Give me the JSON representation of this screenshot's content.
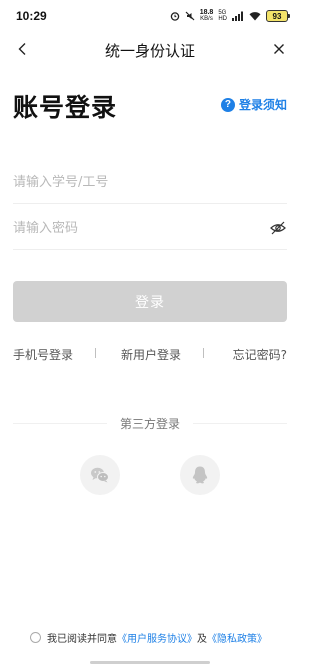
{
  "status_bar": {
    "time": "10:29",
    "net_speed": "18.8",
    "net_unit": "KB/s",
    "net_type_top": "5G",
    "net_type_bottom": "HD",
    "battery": "93",
    "battery_color": "#f3e36a"
  },
  "nav": {
    "title": "统一身份认证",
    "back_icon": "chevron-left-icon",
    "close_icon": "close-icon"
  },
  "page": {
    "heading": "账号登录",
    "notice_label": "登录须知",
    "accent_color": "#1e80e6"
  },
  "form": {
    "username_placeholder": "请输入学号/工号",
    "username_value": "",
    "password_placeholder": "请输入密码",
    "password_value": "",
    "login_label": "登录"
  },
  "links": {
    "phone_login": "手机号登录",
    "register": "新用户登录",
    "forgot": "忘记密码?"
  },
  "third_party": {
    "title": "第三方登录",
    "options": [
      "wechat-icon",
      "qq-icon"
    ]
  },
  "agreement": {
    "prefix": "我已阅读并同意",
    "service_link": "《用户服务协议》",
    "and": "及",
    "privacy_link": "《隐私政策》",
    "checked": false
  }
}
